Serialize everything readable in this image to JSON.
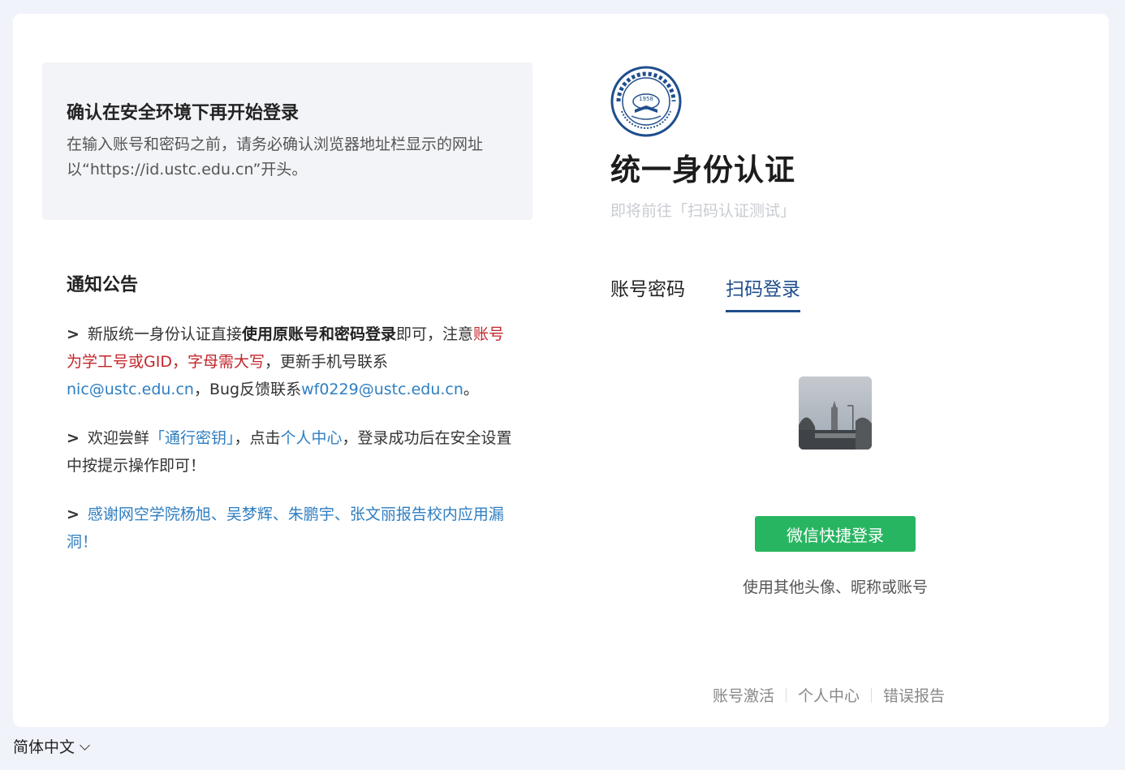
{
  "security_notice": {
    "title": "确认在安全环境下再开始登录",
    "description": "在输入账号和密码之前，请务必确认浏览器地址栏显示的网址以“https://id.ustc.edu.cn”开头。"
  },
  "announcements": {
    "title": "通知公告",
    "item1": {
      "marker": ">",
      "text_a": "新版统一身份认证直接",
      "text_bold": "使用原账号和密码登录",
      "text_b": "即可，注意",
      "text_red": "账号为学工号或GID，字母需大写",
      "text_c": "，更新手机号联系",
      "email1": "nic@ustc.edu.cn",
      "text_d": "，Bug反馈联系",
      "email2": "wf0229@ustc.edu.cn",
      "text_e": "。"
    },
    "item2": {
      "marker": ">",
      "text_a": "欢迎尝鲜",
      "link_passkey": "「通行密钥」",
      "text_b": "，点击",
      "link_center": "个人中心",
      "text_c": "，登录成功后在安全设置中按提示操作即可！"
    },
    "item3": {
      "marker": ">",
      "link_thanks": "感谢网空学院杨旭、吴梦辉、朱鹏宇、张文丽报告校内应用漏洞！"
    }
  },
  "header": {
    "logo_text": "中国科学技术大学",
    "logo_year": "1958",
    "logo_en": "University of Science and Technology of China",
    "title": "统一身份认证",
    "redirect": "即将前往「扫码认证测试」"
  },
  "tabs": [
    {
      "label": "账号密码",
      "active": false
    },
    {
      "label": "扫码登录",
      "active": true
    }
  ],
  "qr_login": {
    "wechat_button": "微信快捷登录",
    "other_account": "使用其他头像、昵称或账号"
  },
  "footer": {
    "links": [
      "账号激活",
      "个人中心",
      "错误报告"
    ]
  },
  "language": {
    "selected": "简体中文"
  },
  "colors": {
    "accent": "#1f4e8c",
    "link": "#2f7ec1",
    "warning_red": "#c2262b",
    "wechat_green": "#28b561",
    "page_bg": "#f1f3fa"
  }
}
